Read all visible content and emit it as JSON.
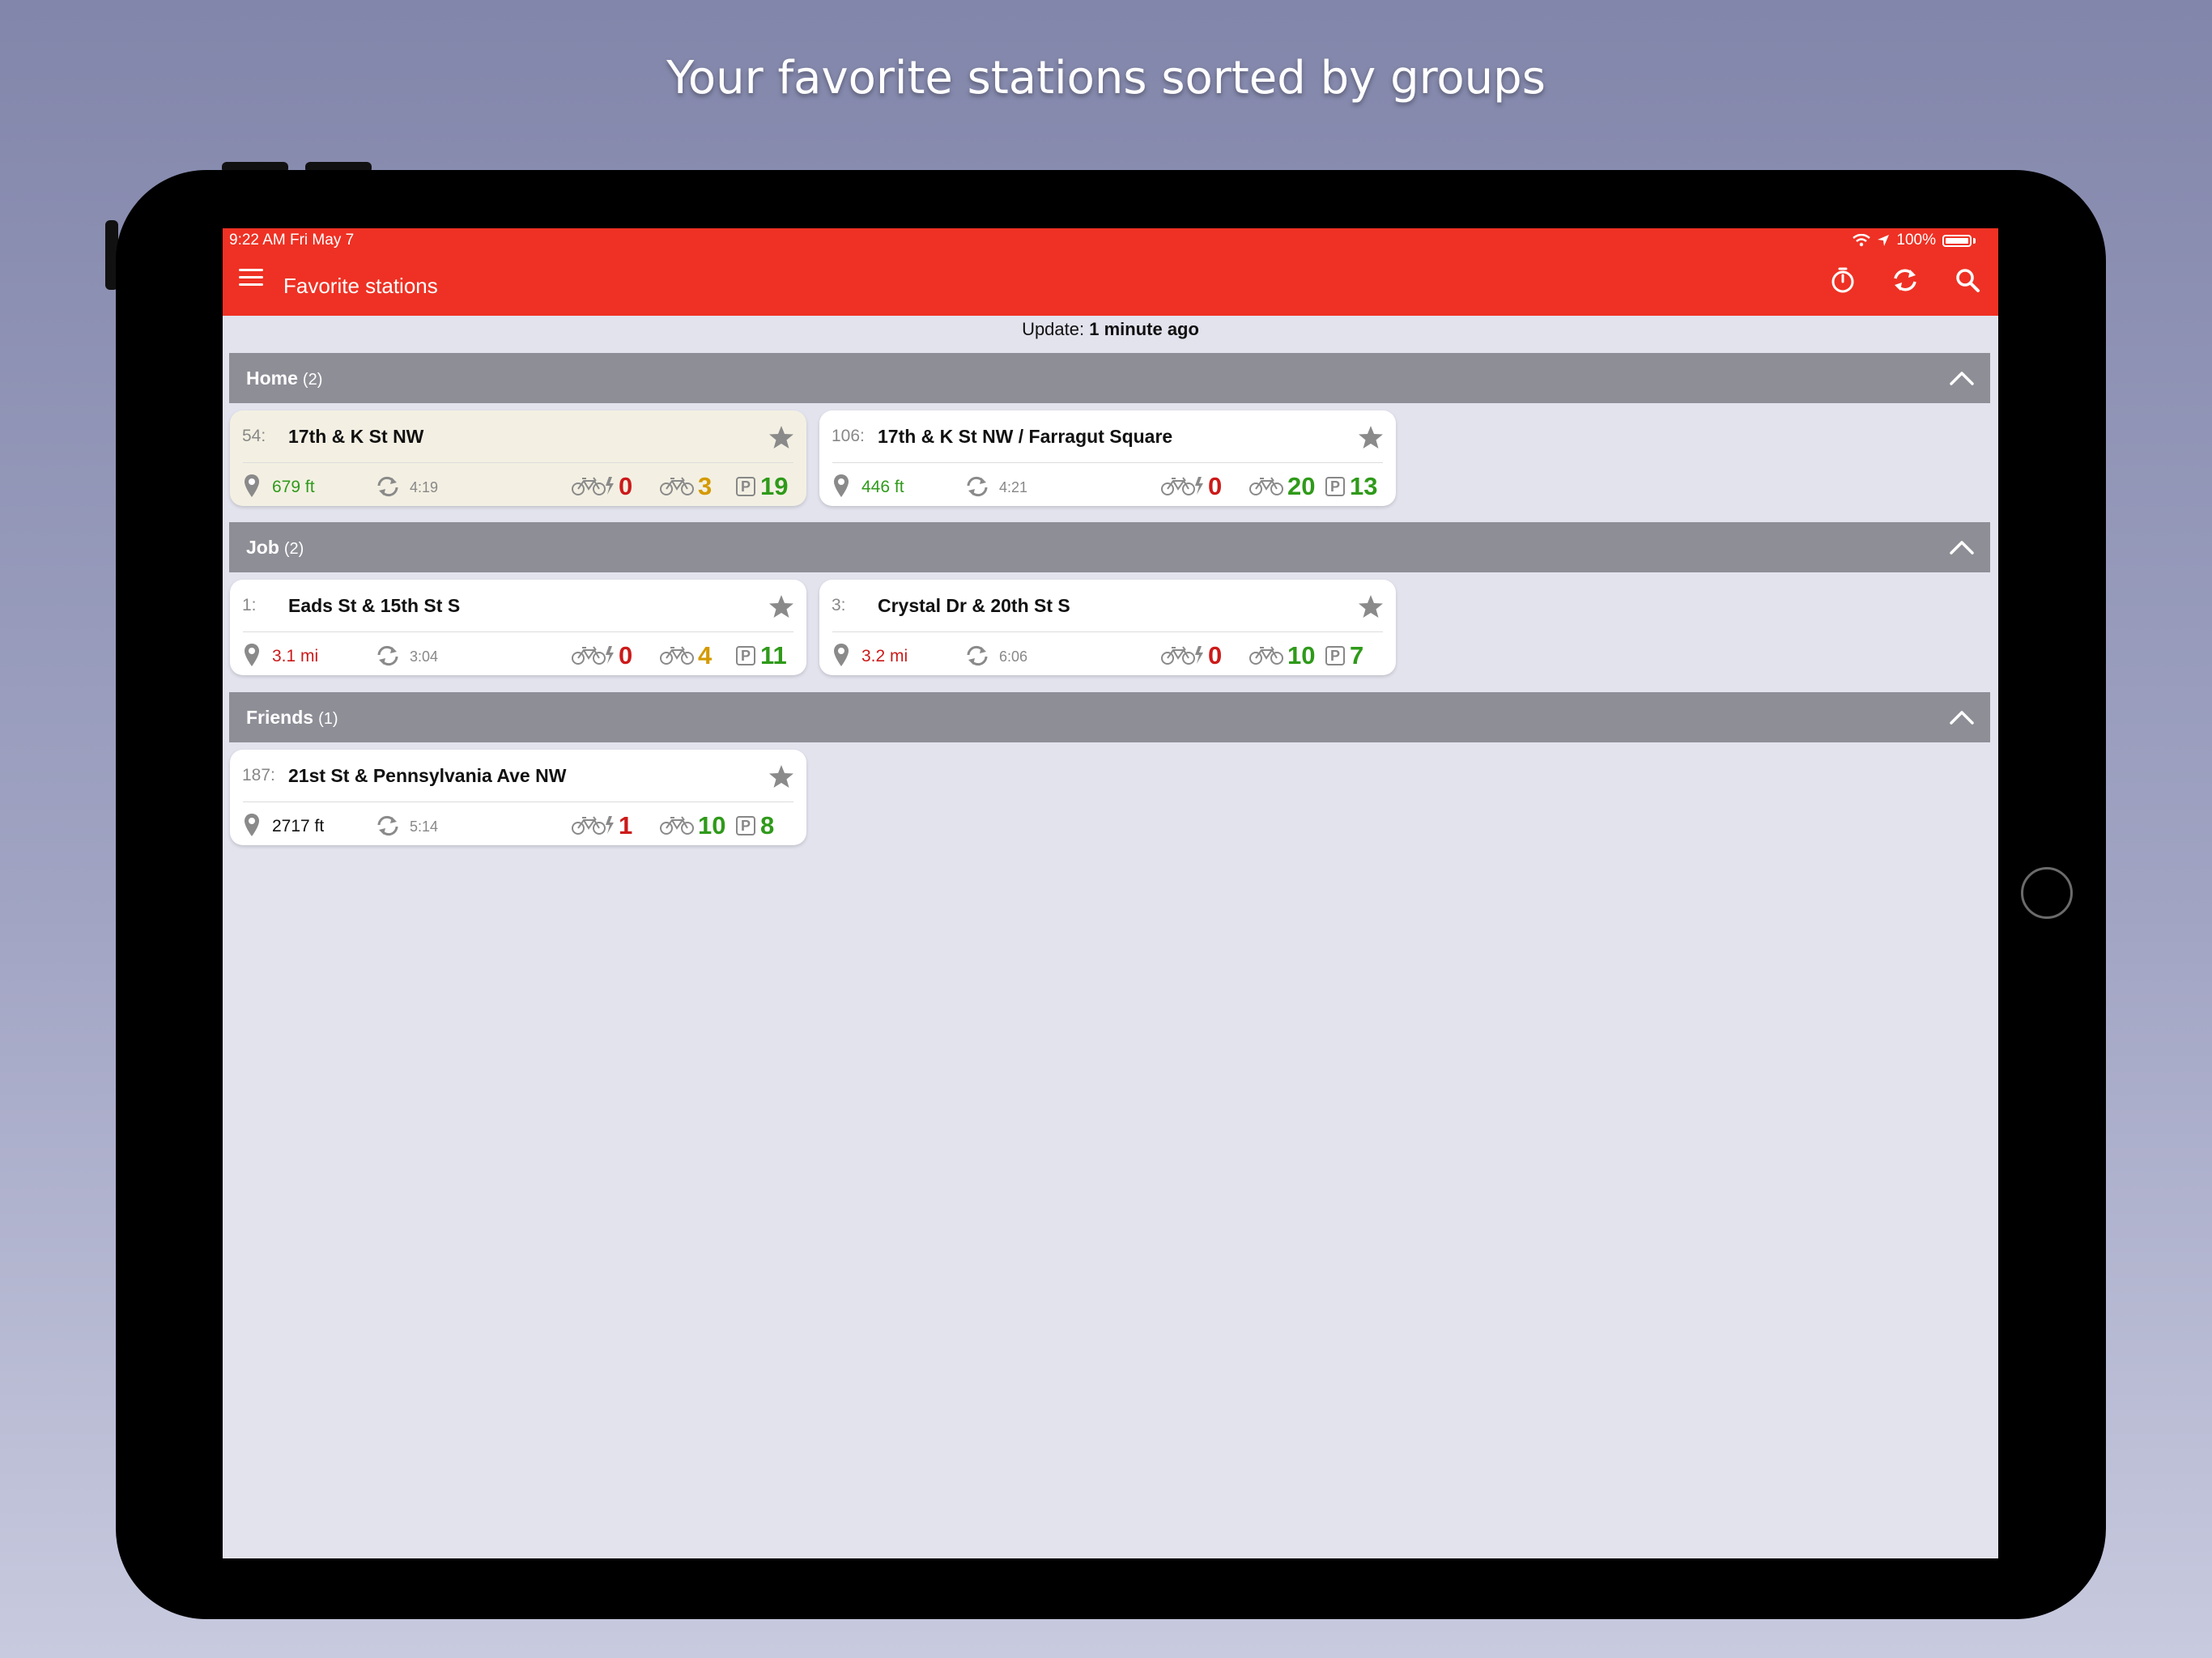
{
  "headline": "Your favorite stations sorted by groups",
  "status_bar": {
    "time": "9:22 AM   Fri May 7",
    "battery": "100%"
  },
  "app_bar": {
    "title": "Favorite stations",
    "icons": [
      "timer-icon",
      "refresh-icon",
      "search-icon"
    ]
  },
  "update": {
    "label": "Update:",
    "value": "1 minute ago"
  },
  "colors": {
    "app_bar": "#ee3124",
    "group_header": "#8e8e97",
    "good": "#2f9a1a",
    "warn": "#d49a00",
    "bad": "#cc1a1a",
    "muted": "#888888"
  },
  "groups": [
    {
      "name": "Home",
      "count": "(2)",
      "stations": [
        {
          "num": "54:",
          "name": "17th & K St NW",
          "distance": "679 ft",
          "distance_color": "#2f9a1a",
          "time": "4:19",
          "ebikes": "0",
          "ebikes_color": "#cc1a1a",
          "bikes": "3",
          "bikes_color": "#d49a00",
          "docks": "19",
          "docks_color": "#2f9a1a",
          "highlighted": true
        },
        {
          "num": "106:",
          "name": "17th & K St NW / Farragut Square",
          "distance": "446 ft",
          "distance_color": "#2f9a1a",
          "time": "4:21",
          "ebikes": "0",
          "ebikes_color": "#cc1a1a",
          "bikes": "20",
          "bikes_color": "#2f9a1a",
          "docks": "13",
          "docks_color": "#2f9a1a",
          "highlighted": false
        }
      ]
    },
    {
      "name": "Job",
      "count": "(2)",
      "stations": [
        {
          "num": "1:",
          "name": "Eads St & 15th St S",
          "distance": "3.1 mi",
          "distance_color": "#cc1a1a",
          "time": "3:04",
          "ebikes": "0",
          "ebikes_color": "#cc1a1a",
          "bikes": "4",
          "bikes_color": "#d49a00",
          "docks": "11",
          "docks_color": "#2f9a1a",
          "highlighted": false
        },
        {
          "num": "3:",
          "name": "Crystal Dr & 20th St S",
          "distance": "3.2 mi",
          "distance_color": "#cc1a1a",
          "time": "6:06",
          "ebikes": "0",
          "ebikes_color": "#cc1a1a",
          "bikes": "10",
          "bikes_color": "#2f9a1a",
          "docks": "7",
          "docks_color": "#2f9a1a",
          "highlighted": false
        }
      ]
    },
    {
      "name": "Friends",
      "count": "(1)",
      "stations": [
        {
          "num": "187:",
          "name": "21st St & Pennsylvania Ave NW",
          "distance": "2717 ft",
          "distance_color": "#111111",
          "time": "5:14",
          "ebikes": "1",
          "ebikes_color": "#cc1a1a",
          "bikes": "10",
          "bikes_color": "#2f9a1a",
          "docks": "8",
          "docks_color": "#2f9a1a",
          "highlighted": false
        }
      ]
    }
  ]
}
